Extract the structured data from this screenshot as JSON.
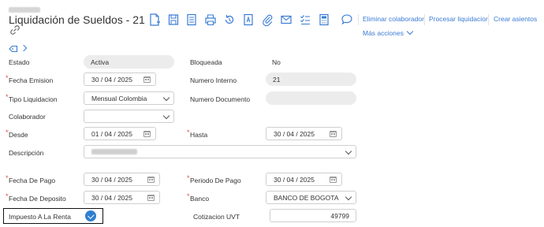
{
  "header": {
    "title": "Liquidación de Sueldos - 21"
  },
  "toolbar": {
    "icons": [
      "new-document-icon",
      "save-icon",
      "document-list-icon",
      "print-icon",
      "history-icon",
      "pdf-icon",
      "attach-icon",
      "email-icon",
      "checklist-icon",
      "calculator-icon",
      "comment-icon"
    ],
    "accent": "#3a7bd5"
  },
  "actions": {
    "eliminar": "Eliminar colaborador",
    "procesar": "Procesar liquidacion",
    "crear": "Crear asientos",
    "more": "Más acciones"
  },
  "form": {
    "estado_label": "Estado",
    "estado_value": "Activa",
    "bloqueada_label": "Bloqueada",
    "bloqueada_value": "No",
    "fecha_emision_label": "Fecha Emision",
    "fecha_emision_value": "30 / 04 / 2025",
    "numero_interno_label": "Numero Interno",
    "numero_interno_value": "21",
    "tipo_liquidacion_label": "Tipo Liquidacion",
    "tipo_liquidacion_value": "Mensual Colombia",
    "numero_documento_label": "Numero Documento",
    "numero_documento_value": "",
    "colaborador_label": "Colaborador",
    "colaborador_value": "",
    "desde_label": "Desde",
    "desde_value": "01 / 04 / 2025",
    "hasta_label": "Hasta",
    "hasta_value": "30 / 04 / 2025",
    "descripcion_label": "Descripción",
    "fecha_pago_label": "Fecha De Pago",
    "fecha_pago_value": "30 / 04 / 2025",
    "periodo_pago_label": "Periodo De Pago",
    "periodo_pago_value": "30 / 04 / 2025",
    "fecha_deposito_label": "Fecha De Deposito",
    "fecha_deposito_value": "30 / 04 / 2025",
    "banco_label": "Banco",
    "banco_value": "BANCO DE BOGOTA",
    "impuesto_label": "Impuesto A La Renta",
    "impuesto_checked": true,
    "cotizacion_label": "Cotizacion UVT",
    "cotizacion_value": "49799"
  }
}
